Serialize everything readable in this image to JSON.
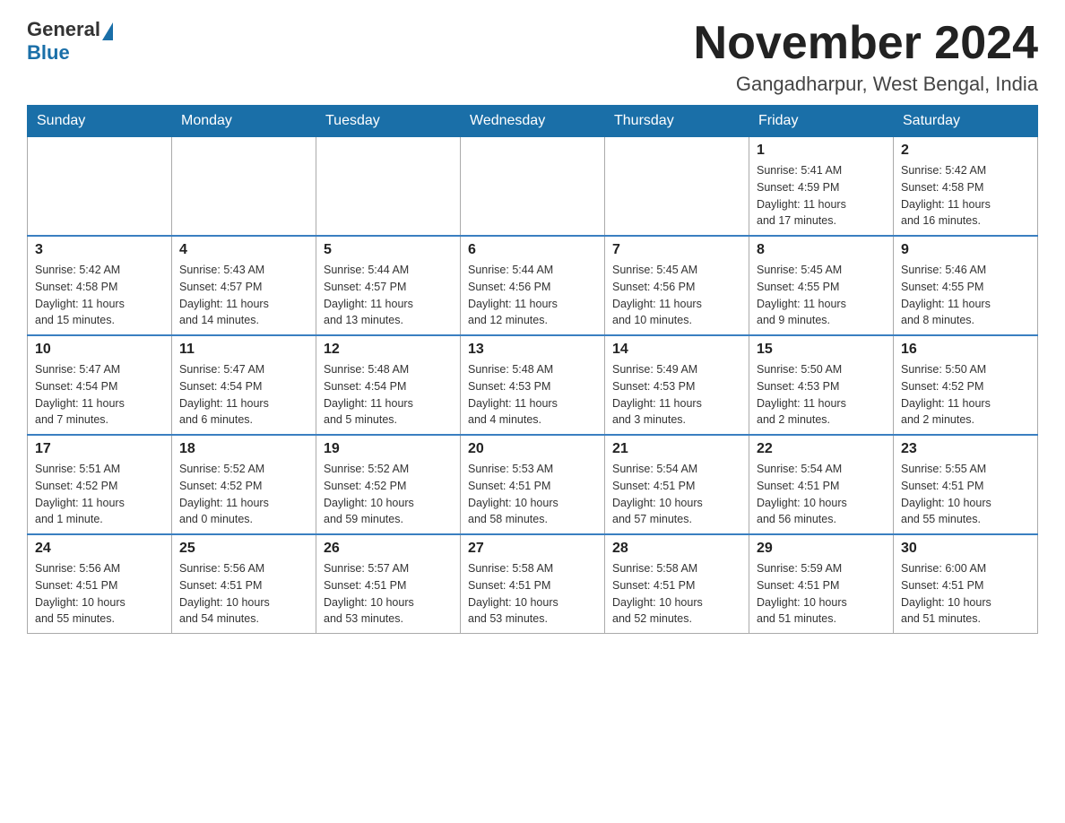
{
  "header": {
    "logo": {
      "general_text": "General",
      "blue_text": "Blue"
    },
    "title": "November 2024",
    "location": "Gangadharpur, West Bengal, India"
  },
  "weekdays": [
    "Sunday",
    "Monday",
    "Tuesday",
    "Wednesday",
    "Thursday",
    "Friday",
    "Saturday"
  ],
  "weeks": [
    [
      {
        "day": "",
        "info": ""
      },
      {
        "day": "",
        "info": ""
      },
      {
        "day": "",
        "info": ""
      },
      {
        "day": "",
        "info": ""
      },
      {
        "day": "",
        "info": ""
      },
      {
        "day": "1",
        "info": "Sunrise: 5:41 AM\nSunset: 4:59 PM\nDaylight: 11 hours\nand 17 minutes."
      },
      {
        "day": "2",
        "info": "Sunrise: 5:42 AM\nSunset: 4:58 PM\nDaylight: 11 hours\nand 16 minutes."
      }
    ],
    [
      {
        "day": "3",
        "info": "Sunrise: 5:42 AM\nSunset: 4:58 PM\nDaylight: 11 hours\nand 15 minutes."
      },
      {
        "day": "4",
        "info": "Sunrise: 5:43 AM\nSunset: 4:57 PM\nDaylight: 11 hours\nand 14 minutes."
      },
      {
        "day": "5",
        "info": "Sunrise: 5:44 AM\nSunset: 4:57 PM\nDaylight: 11 hours\nand 13 minutes."
      },
      {
        "day": "6",
        "info": "Sunrise: 5:44 AM\nSunset: 4:56 PM\nDaylight: 11 hours\nand 12 minutes."
      },
      {
        "day": "7",
        "info": "Sunrise: 5:45 AM\nSunset: 4:56 PM\nDaylight: 11 hours\nand 10 minutes."
      },
      {
        "day": "8",
        "info": "Sunrise: 5:45 AM\nSunset: 4:55 PM\nDaylight: 11 hours\nand 9 minutes."
      },
      {
        "day": "9",
        "info": "Sunrise: 5:46 AM\nSunset: 4:55 PM\nDaylight: 11 hours\nand 8 minutes."
      }
    ],
    [
      {
        "day": "10",
        "info": "Sunrise: 5:47 AM\nSunset: 4:54 PM\nDaylight: 11 hours\nand 7 minutes."
      },
      {
        "day": "11",
        "info": "Sunrise: 5:47 AM\nSunset: 4:54 PM\nDaylight: 11 hours\nand 6 minutes."
      },
      {
        "day": "12",
        "info": "Sunrise: 5:48 AM\nSunset: 4:54 PM\nDaylight: 11 hours\nand 5 minutes."
      },
      {
        "day": "13",
        "info": "Sunrise: 5:48 AM\nSunset: 4:53 PM\nDaylight: 11 hours\nand 4 minutes."
      },
      {
        "day": "14",
        "info": "Sunrise: 5:49 AM\nSunset: 4:53 PM\nDaylight: 11 hours\nand 3 minutes."
      },
      {
        "day": "15",
        "info": "Sunrise: 5:50 AM\nSunset: 4:53 PM\nDaylight: 11 hours\nand 2 minutes."
      },
      {
        "day": "16",
        "info": "Sunrise: 5:50 AM\nSunset: 4:52 PM\nDaylight: 11 hours\nand 2 minutes."
      }
    ],
    [
      {
        "day": "17",
        "info": "Sunrise: 5:51 AM\nSunset: 4:52 PM\nDaylight: 11 hours\nand 1 minute."
      },
      {
        "day": "18",
        "info": "Sunrise: 5:52 AM\nSunset: 4:52 PM\nDaylight: 11 hours\nand 0 minutes."
      },
      {
        "day": "19",
        "info": "Sunrise: 5:52 AM\nSunset: 4:52 PM\nDaylight: 10 hours\nand 59 minutes."
      },
      {
        "day": "20",
        "info": "Sunrise: 5:53 AM\nSunset: 4:51 PM\nDaylight: 10 hours\nand 58 minutes."
      },
      {
        "day": "21",
        "info": "Sunrise: 5:54 AM\nSunset: 4:51 PM\nDaylight: 10 hours\nand 57 minutes."
      },
      {
        "day": "22",
        "info": "Sunrise: 5:54 AM\nSunset: 4:51 PM\nDaylight: 10 hours\nand 56 minutes."
      },
      {
        "day": "23",
        "info": "Sunrise: 5:55 AM\nSunset: 4:51 PM\nDaylight: 10 hours\nand 55 minutes."
      }
    ],
    [
      {
        "day": "24",
        "info": "Sunrise: 5:56 AM\nSunset: 4:51 PM\nDaylight: 10 hours\nand 55 minutes."
      },
      {
        "day": "25",
        "info": "Sunrise: 5:56 AM\nSunset: 4:51 PM\nDaylight: 10 hours\nand 54 minutes."
      },
      {
        "day": "26",
        "info": "Sunrise: 5:57 AM\nSunset: 4:51 PM\nDaylight: 10 hours\nand 53 minutes."
      },
      {
        "day": "27",
        "info": "Sunrise: 5:58 AM\nSunset: 4:51 PM\nDaylight: 10 hours\nand 53 minutes."
      },
      {
        "day": "28",
        "info": "Sunrise: 5:58 AM\nSunset: 4:51 PM\nDaylight: 10 hours\nand 52 minutes."
      },
      {
        "day": "29",
        "info": "Sunrise: 5:59 AM\nSunset: 4:51 PM\nDaylight: 10 hours\nand 51 minutes."
      },
      {
        "day": "30",
        "info": "Sunrise: 6:00 AM\nSunset: 4:51 PM\nDaylight: 10 hours\nand 51 minutes."
      }
    ]
  ]
}
